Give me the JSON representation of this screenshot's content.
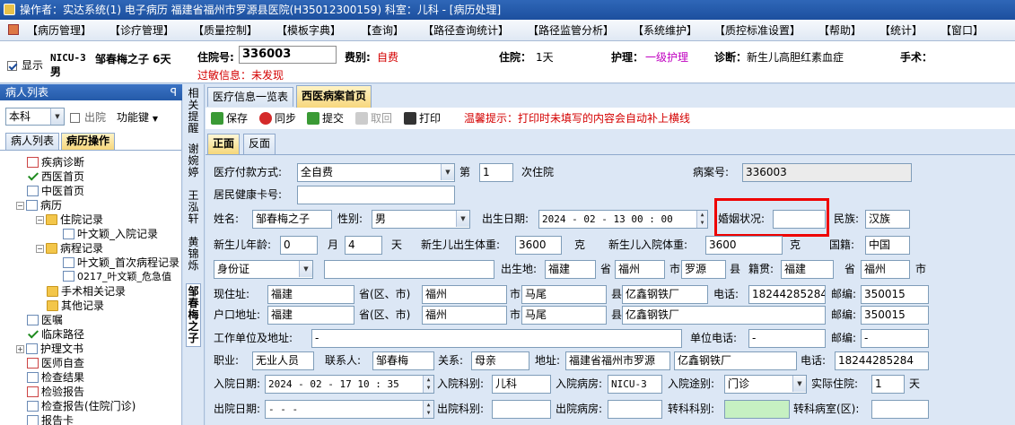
{
  "titlebar": {
    "text": "操作者：实达系统(1) 电子病历  福建省福州市罗源县医院(H35012300159)  科室：儿科 - [病历处理]"
  },
  "menu": [
    "【病历管理】",
    "【诊疗管理】",
    "【质量控制】",
    "【模板字典】",
    "【查询】",
    "【路径查询统计】",
    "【路径监管分析】",
    "【系统维护】",
    "【质控标准设置】",
    "【帮助】",
    "【统计】",
    "【窗口】"
  ],
  "patient": {
    "show_label": "显示",
    "bed": "NICU-3",
    "name": "邹春梅之子 6天",
    "gender": "男",
    "inpatient_no_label": "住院号:",
    "inpatient_no": "336003",
    "fee_label": "费别:",
    "fee": "自费",
    "stay_label": "住院：",
    "stay": "1天",
    "nursing_label": "护理：",
    "nursing": "一级护理",
    "diagnosis_label": "诊断：",
    "diagnosis": "新生儿高胆红素血症",
    "surgery_label": "手术：",
    "allergy_label": "过敏信息：",
    "allergy": "未发现"
  },
  "left": {
    "header": "病人列表",
    "pin": "ꟼ",
    "dept": "本科",
    "discharged_label": "出院",
    "func_key": "功能键",
    "tabs": [
      "病人列表",
      "病历操作"
    ],
    "tree": [
      {
        "label": "疾病诊断",
        "icon": "doc-red-icon"
      },
      {
        "label": "西医首页",
        "icon": "check-icon"
      },
      {
        "label": "中医首页",
        "icon": "doc-icon"
      },
      {
        "label": "病历",
        "icon": "doc-icon"
      },
      {
        "label": "住院记录",
        "icon": "folder-icon"
      },
      {
        "label": "叶文颖_入院记录",
        "icon": "doc-icon"
      },
      {
        "label": "病程记录",
        "icon": "folder-icon"
      },
      {
        "label": "叶文颖_首次病程记录",
        "icon": "doc-icon"
      },
      {
        "label": "0217_叶文颖_危急值",
        "icon": "doc-icon"
      },
      {
        "label": "手术相关记录",
        "icon": "folder-icon"
      },
      {
        "label": "其他记录",
        "icon": "folder-icon"
      },
      {
        "label": "医嘱",
        "icon": "doc-icon"
      },
      {
        "label": "临床路径",
        "icon": "check-icon"
      },
      {
        "label": "护理文书",
        "icon": "doc-icon"
      },
      {
        "label": "医师自查",
        "icon": "doc-red-icon"
      },
      {
        "label": "检查结果",
        "icon": "doc-icon"
      },
      {
        "label": "检验报告",
        "icon": "doc-red-icon"
      },
      {
        "label": "检查报告(住院门诊)",
        "icon": "doc-icon"
      },
      {
        "label": "报告卡",
        "icon": "doc-icon"
      }
    ]
  },
  "vtabs": [
    "相关提醒",
    "谢婉婷",
    "王泓轩",
    "黄锦烁",
    "邹春梅之子"
  ],
  "doc_tabs": [
    "医疗信息一览表",
    "西医病案首页"
  ],
  "toolbar": {
    "save": "保存",
    "sync": "同步",
    "submit": "提交",
    "revoke": "取回",
    "print": "打印",
    "hint": "温馨提示：打印时未填写的内容会自动补上横线"
  },
  "sub_tabs": [
    "正面",
    "反面"
  ],
  "form": {
    "pay_label": "医疗付款方式:",
    "pay": "全自费",
    "nth_label": "第",
    "nth": "1",
    "nth_suffix": "次住院",
    "record_no_label": "病案号:",
    "record_no": "336003",
    "health_card_label": "居民健康卡号:",
    "health_card": "",
    "name_label": "姓名:",
    "name": "邹春梅之子",
    "gender_label": "性别:",
    "gender": "男",
    "birth_label": "出生日期:",
    "birth": "2024 - 02 - 13   00 : 00",
    "marital_label": "婚姻状况:",
    "marital": "",
    "nation_label": "民族:",
    "nation": "汉族",
    "nb_age_label": "新生儿年龄:",
    "nb_age": "0",
    "month_label": "月",
    "days": "4",
    "day_label": "天",
    "nb_weight_label": "新生儿出生体重:",
    "nb_weight": "3600",
    "g1": "克",
    "nb_adm_weight_label": "新生儿入院体重:",
    "nb_adm_weight": "3600",
    "g2": "克",
    "country_label": "国籍:",
    "country": "中国",
    "id_type": "身份证",
    "id_no": "",
    "birthplace_label": "出生地:",
    "birth_prov": "福建",
    "prov1": "省",
    "birth_city": "福州",
    "city1": "市",
    "birth_county": "罗源",
    "county1": "县",
    "origin_label": "籍贯:",
    "origin_prov": "福建",
    "prov2": "省",
    "origin_city": "福州",
    "city2": "市",
    "cur_addr_label": "现住址:",
    "cur_prov": "福建",
    "cur_region_label": "省(区、市)",
    "cur_city": "福州",
    "city3": "市",
    "cur_county": "马尾",
    "county3": "县",
    "cur_detail": "亿鑫钢铁厂",
    "phone_label": "电话:",
    "phone": "18244285284",
    "zip_label": "邮编:",
    "zip": "350015",
    "hukou_label": "户口地址:",
    "hk_prov": "福建",
    "hk_region_label": "省(区、市)",
    "hk_city": "福州",
    "city4": "市",
    "hk_county": "马尾",
    "county4": "县",
    "hk_detail": "亿鑫钢铁厂",
    "zip2_label": "邮编:",
    "zip2": "350015",
    "work_label": "工作单位及地址:",
    "work": "-",
    "work_phone_label": "单位电话:",
    "work_phone": "-",
    "zip3_label": "邮编:",
    "zip3": "-",
    "job_label": "职业:",
    "job": "无业人员",
    "contact_label": "联系人:",
    "contact": "邹春梅",
    "relation_label": "关系:",
    "relation": "母亲",
    "caddr_label": "地址:",
    "caddr1": "福建省福州市罗源",
    "caddr2": "亿鑫钢铁厂",
    "cphone_label": "电话:",
    "cphone": "18244285284",
    "adm_date_label": "入院日期:",
    "adm_date": "2024 - 02 - 17   10 : 35",
    "adm_dept_label": "入院科别:",
    "adm_dept": "儿科",
    "adm_ward_label": "入院病房:",
    "adm_ward": "NICU-3",
    "adm_route_label": "入院途别:",
    "adm_route": "门诊",
    "actual_stay_label": "实际住院:",
    "actual_stay": "1",
    "actual_day": "天",
    "dis_date_label": "出院日期:",
    "dis_date": "-    -       -",
    "dis_dept_label": "出院科别:",
    "dis_dept": "",
    "dis_ward_label": "出院病房:",
    "dis_ward": "",
    "transfer_label": "转科科别:",
    "transfer": "",
    "transfer_ward_label": "转科病室(区):",
    "transfer_ward": ""
  }
}
